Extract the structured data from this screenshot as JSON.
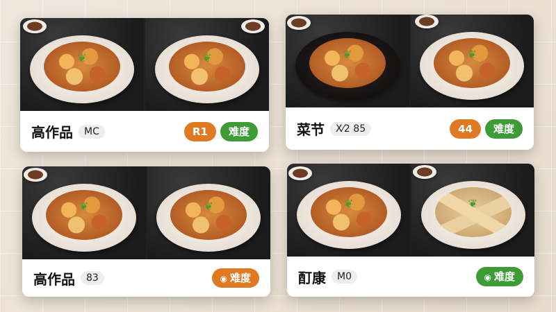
{
  "colors": {
    "orange": "#e07a22",
    "green": "#3f9b36",
    "background": "#e9e1d3"
  },
  "cards": [
    {
      "title": "高作品",
      "tag": "MC",
      "badges": [
        {
          "text": "R1",
          "color": "orange"
        },
        {
          "text": "难度",
          "color": "green"
        }
      ]
    },
    {
      "title": "菜节",
      "tag": "X⁄2 85",
      "badges": [
        {
          "text": "44",
          "color": "orange"
        },
        {
          "text": "难度",
          "color": "green"
        }
      ]
    },
    {
      "title": "高作品",
      "tag": "83",
      "badges": [
        {
          "text": "难度",
          "color": "orange",
          "icon": "dish-icon"
        }
      ]
    },
    {
      "title": "酊康",
      "tag": "M0",
      "badges": [
        {
          "text": "难度",
          "color": "green",
          "icon": "dish-icon"
        }
      ]
    }
  ]
}
